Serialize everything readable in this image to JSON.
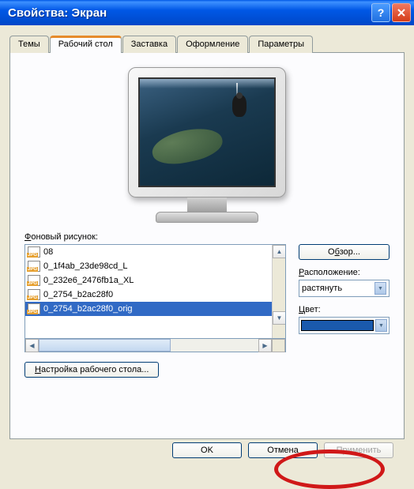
{
  "window": {
    "title": "Свойства: Экран"
  },
  "tabs": [
    "Темы",
    "Рабочий стол",
    "Заставка",
    "Оформление",
    "Параметры"
  ],
  "activeTab": 1,
  "bgListLabel": "Фоновый рисунок:",
  "files": [
    "08",
    "0_1f4ab_23de98cd_L",
    "0_232e6_2476fb1a_XL",
    "0_2754_b2ac28f0",
    "0_2754_b2ac28f0_orig"
  ],
  "selectedFile": 4,
  "browseBtn": "Обзор...",
  "positionLabel": "Расположение:",
  "positionValue": "растянуть",
  "colorLabel": "Цвет:",
  "colorValue": "#1a5aad",
  "customizeBtn": "Настройка рабочего стола...",
  "dialog": {
    "ok": "OK",
    "cancel": "Отмена",
    "apply": "Применить"
  }
}
